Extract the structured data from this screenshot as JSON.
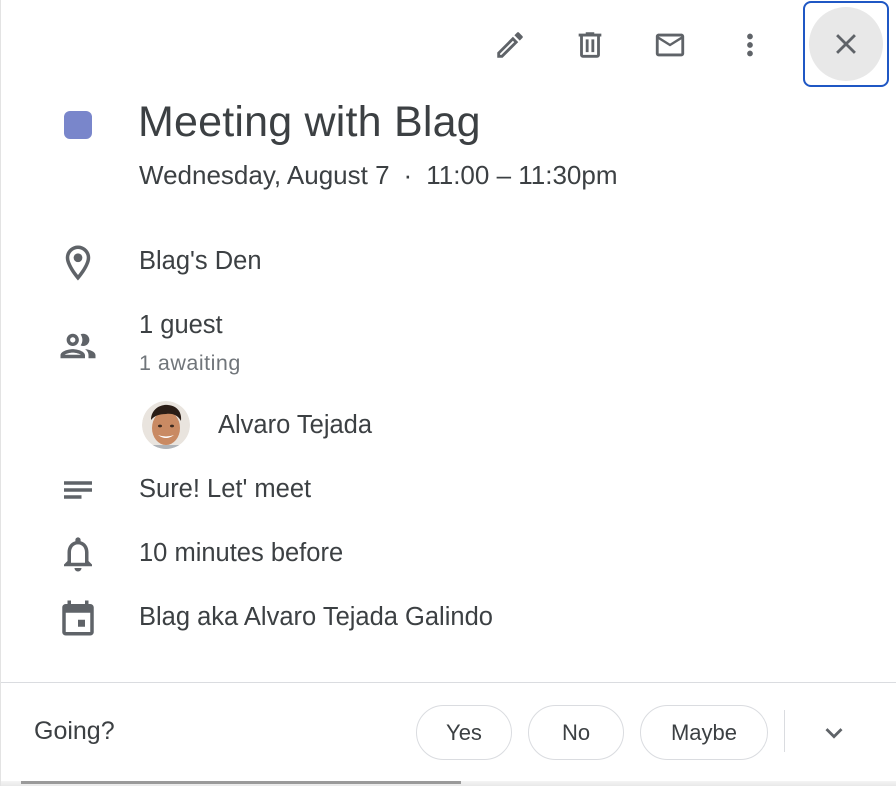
{
  "toolbar": {
    "edit_icon": "pencil-icon",
    "delete_icon": "trash-icon",
    "email_icon": "envelope-icon",
    "more_icon": "more-vert-icon",
    "close_icon": "close-icon"
  },
  "event": {
    "color": "#7986cb",
    "title": "Meeting with Blag",
    "date": "Wednesday, August 7",
    "separator": "·",
    "time": "11:00 – 11:30pm"
  },
  "location": {
    "icon": "location-pin-icon",
    "text": "Blag's Den"
  },
  "guests": {
    "icon": "people-icon",
    "count_text": "1 guest",
    "status_text": "1 awaiting",
    "list": [
      {
        "name": "Alvaro Tejada"
      }
    ]
  },
  "description": {
    "icon": "notes-icon",
    "text": "Sure! Let' meet"
  },
  "reminder": {
    "icon": "bell-icon",
    "text": "10 minutes before"
  },
  "calendar": {
    "icon": "calendar-icon",
    "text": "Blag aka Alvaro Tejada Galindo"
  },
  "rsvp": {
    "label": "Going?",
    "options": [
      "Yes",
      "No",
      "Maybe"
    ],
    "expand_icon": "chevron-down-icon"
  },
  "colors": {
    "accent_focus": "#1f57c4",
    "icon_gray": "#5f6368"
  }
}
